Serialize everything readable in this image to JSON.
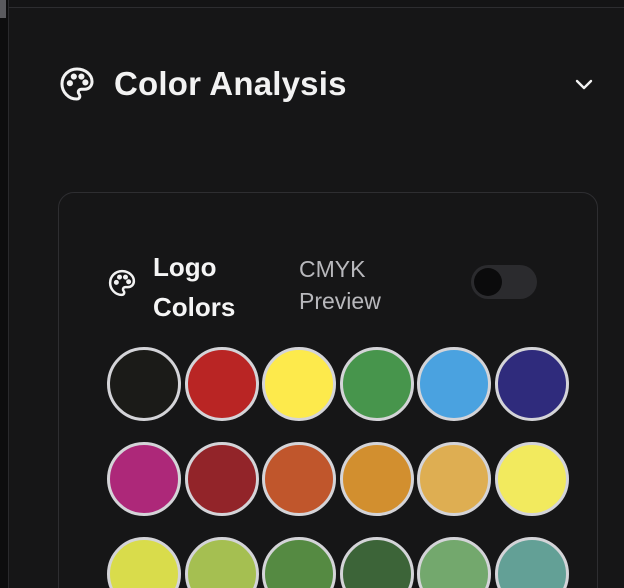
{
  "section": {
    "title": "Color Analysis",
    "palette_icon": "palette-icon",
    "chevron_icon": "chevron-down-icon"
  },
  "logo_colors": {
    "title": "Logo Colors",
    "cmyk_label": "CMYK Preview",
    "cmyk_preview_enabled": false,
    "swatches": [
      "#1b1b18",
      "#b92524",
      "#fdea4c",
      "#47954c",
      "#4aa2e0",
      "#2f2b7c",
      "#ad2879",
      "#922429",
      "#c0562c",
      "#d28f2f",
      "#deae52",
      "#f2ea5e",
      "#d9dc4b",
      "#a5bf51",
      "#558a42",
      "#3c6438",
      "#73a86d",
      "#63a096"
    ]
  },
  "colors": {
    "background": "#161617",
    "card_border": "#2e2e31",
    "text_primary": "#f2f2f2",
    "text_secondary": "#b8b8bc",
    "swatch_ring": "#d4d4d8"
  }
}
